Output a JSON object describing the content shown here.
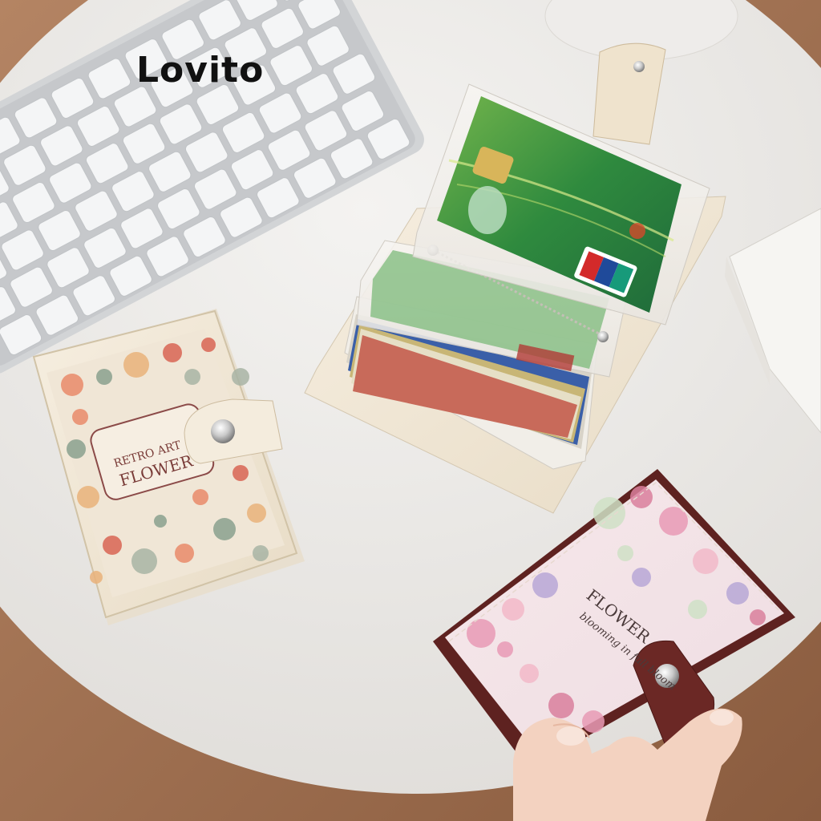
{
  "brand": {
    "logo_text": "Lovito"
  },
  "products": {
    "left_wallet": {
      "label_line1": "RETRO ART",
      "label_line2": "FLOWER",
      "style": "cream floral"
    },
    "open_wallet": {
      "style": "cream leather with clear card sleeves"
    },
    "right_wallet": {
      "title": "FLOWER",
      "subtitle": "blooming in full bloom",
      "style": "burgundy trim pink floral"
    }
  },
  "colors": {
    "table": "#ebe9e6",
    "floor": "#9a6d4e",
    "cream": "#f1e6d3",
    "burgundy": "#6e2a28",
    "card_green": "#3a8a3a"
  }
}
